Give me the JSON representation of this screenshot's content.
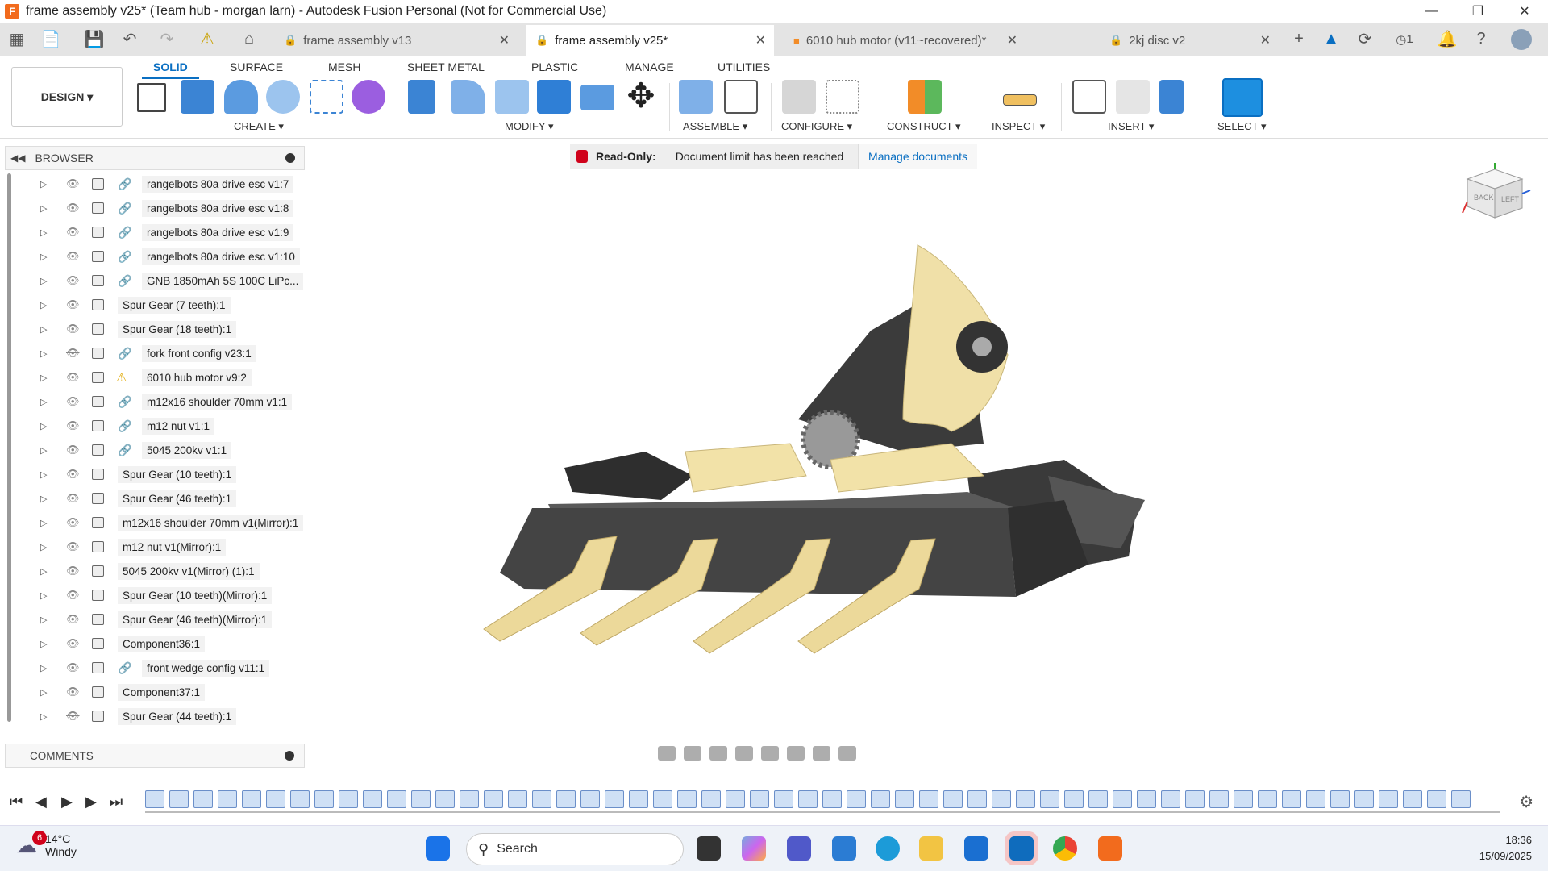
{
  "window": {
    "title": "frame assembly v25* (Team hub - morgan larn) - Autodesk Fusion Personal (Not for Commercial Use)"
  },
  "doc_tabs": [
    {
      "label": "frame assembly v13",
      "active": false
    },
    {
      "label": "frame assembly v25*",
      "active": true
    },
    {
      "label": "6010 hub motor (v11~recovered)*",
      "active": false
    },
    {
      "label": "2kj disc v2",
      "active": false
    }
  ],
  "ribbon": {
    "workspace": "DESIGN",
    "tabs": [
      "SOLID",
      "SURFACE",
      "MESH",
      "SHEET METAL",
      "PLASTIC",
      "MANAGE",
      "UTILITIES"
    ],
    "groups": [
      "CREATE",
      "MODIFY",
      "ASSEMBLE",
      "CONFIGURE",
      "CONSTRUCT",
      "INSPECT",
      "INSERT",
      "SELECT"
    ]
  },
  "browser": {
    "title": "BROWSER",
    "items": [
      {
        "label": "rangelbots 80a drive esc v1:7",
        "link": true,
        "visible": true
      },
      {
        "label": "rangelbots 80a drive esc v1:8",
        "link": true,
        "visible": true
      },
      {
        "label": "rangelbots 80a drive esc v1:9",
        "link": true,
        "visible": true
      },
      {
        "label": "rangelbots 80a drive esc v1:10",
        "link": true,
        "visible": true
      },
      {
        "label": "GNB 1850mAh 5S 100C LiPc...",
        "link": true,
        "visible": true
      },
      {
        "label": "Spur Gear (7 teeth):1",
        "link": false,
        "visible": true
      },
      {
        "label": "Spur Gear (18 teeth):1",
        "link": false,
        "visible": true
      },
      {
        "label": "fork front config v23:1",
        "link": true,
        "visible": false
      },
      {
        "label": "6010 hub motor v9:2",
        "link": false,
        "warn": true,
        "visible": true
      },
      {
        "label": "m12x16 shoulder 70mm v1:1",
        "link": true,
        "visible": true
      },
      {
        "label": "m12 nut v1:1",
        "link": true,
        "visible": true
      },
      {
        "label": "5045 200kv v1:1",
        "link": true,
        "visible": true
      },
      {
        "label": "Spur Gear (10 teeth):1",
        "link": false,
        "visible": true
      },
      {
        "label": "Spur Gear (46 teeth):1",
        "link": false,
        "visible": true
      },
      {
        "label": "m12x16 shoulder 70mm v1(Mirror):1",
        "link": false,
        "visible": true
      },
      {
        "label": "m12 nut v1(Mirror):1",
        "link": false,
        "visible": true
      },
      {
        "label": "5045 200kv v1(Mirror) (1):1",
        "link": false,
        "visible": true
      },
      {
        "label": "Spur Gear (10 teeth)(Mirror):1",
        "link": false,
        "visible": true
      },
      {
        "label": "Spur Gear (46 teeth)(Mirror):1",
        "link": false,
        "visible": true
      },
      {
        "label": "Component36:1",
        "link": false,
        "visible": true
      },
      {
        "label": "front wedge config v11:1",
        "link": true,
        "visible": true
      },
      {
        "label": "Component37:1",
        "link": false,
        "visible": true
      },
      {
        "label": "Spur Gear (44 teeth):1",
        "link": false,
        "visible": false
      }
    ]
  },
  "comments": {
    "title": "COMMENTS"
  },
  "banner": {
    "title": "Read-Only:",
    "message": "Document limit has been reached",
    "action": "Manage documents"
  },
  "viewcube": {
    "faces": [
      "BACK",
      "LEFT"
    ]
  },
  "taskbar": {
    "temperature": "14°C",
    "condition": "Windy",
    "weather_badge": "6",
    "search_placeholder": "Search",
    "time": "18:36",
    "date": "15/09/2025"
  },
  "quick_access": {
    "notification_count": "1"
  }
}
